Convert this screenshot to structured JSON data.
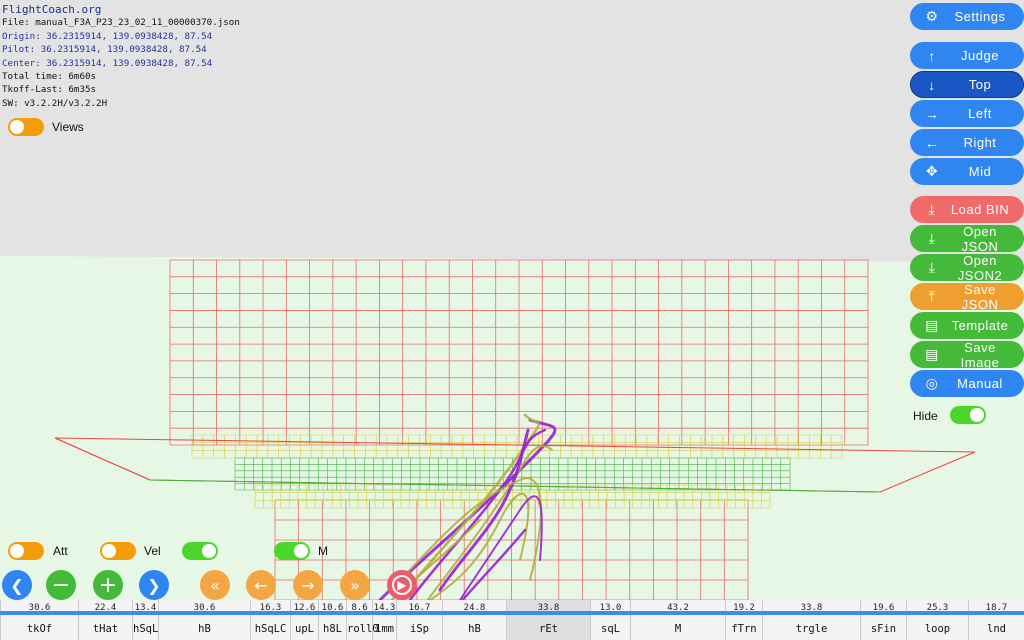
{
  "info": {
    "brand": "FlightCoach.org",
    "file": "File: manual_F3A_P23_23_02_11_00000370.json",
    "origin": "Origin: 36.2315914, 139.0938428, 87.54",
    "pilot": "Pilot: 36.2315914, 139.0938428, 87.54",
    "center": "Center: 36.2315914, 139.0938428, 87.54",
    "total_time": "Total time: 6m60s",
    "tkoff_last": "Tkoff-Last: 6m35s",
    "sw": "SW: v3.2.2H/v3.2.2H"
  },
  "toggles": {
    "views": {
      "label": "Views",
      "state": "off"
    },
    "att": {
      "label": "Att",
      "state": "off"
    },
    "vel": {
      "label": "Vel",
      "state": "off"
    },
    "extra": {
      "state": "on"
    },
    "m": {
      "label": "M",
      "state": "on"
    },
    "hide": {
      "label": "Hide",
      "state": "on"
    }
  },
  "right_panel": {
    "settings": "Settings",
    "judge": "Judge",
    "top": "Top",
    "left": "Left",
    "right": "Right",
    "mid": "Mid",
    "load_bin": "Load BIN",
    "open_json": "Open JSON",
    "open_json2": "Open JSON2",
    "save_json": "Save JSON",
    "template": "Template",
    "save_image": "Save Image",
    "manual": "Manual",
    "selected_view": "Top"
  },
  "playback": {
    "icons": [
      "chevron-left-icon",
      "minus-icon",
      "plus-icon",
      "chevron-right-icon",
      "double-left-icon",
      "arrow-left-icon",
      "arrow-right-icon",
      "double-right-icon",
      "play-icon"
    ]
  },
  "timeline": {
    "segments": [
      {
        "name": "tkOf",
        "dur": "30.6"
      },
      {
        "name": "tHat",
        "dur": "22.4"
      },
      {
        "name": "hSqL",
        "dur": "13.4"
      },
      {
        "name": "hB",
        "dur": "30.6"
      },
      {
        "name": "hSqLC",
        "dur": "16.3"
      },
      {
        "name": "upL",
        "dur": "12.6"
      },
      {
        "name": "h8L",
        "dur": "10.6"
      },
      {
        "name": "roll0",
        "dur": "8.6"
      },
      {
        "name": "1mm",
        "dur": "14.3"
      },
      {
        "name": "iSp",
        "dur": "16.7"
      },
      {
        "name": "hB",
        "dur": "24.8"
      },
      {
        "name": "rEt",
        "dur": "33.8"
      },
      {
        "name": "sqL",
        "dur": "13.0"
      },
      {
        "name": "M",
        "dur": "43.2"
      },
      {
        "name": "fTrn",
        "dur": "19.2"
      },
      {
        "name": "trgle",
        "dur": "33.8"
      },
      {
        "name": "sFin",
        "dur": "19.6"
      },
      {
        "name": "loop",
        "dur": "25.3"
      },
      {
        "name": "lnd",
        "dur": "18.7"
      }
    ]
  },
  "colors": {
    "ground": "#e6f7e6",
    "sky": "#e3e3e3",
    "grid_red": "#ec6a6a",
    "grid_green": "#3fb53f",
    "grid_yellow": "#d8cc40",
    "trace_purple": "#9a1fd0",
    "trace_olive": "#b3ad3a"
  }
}
